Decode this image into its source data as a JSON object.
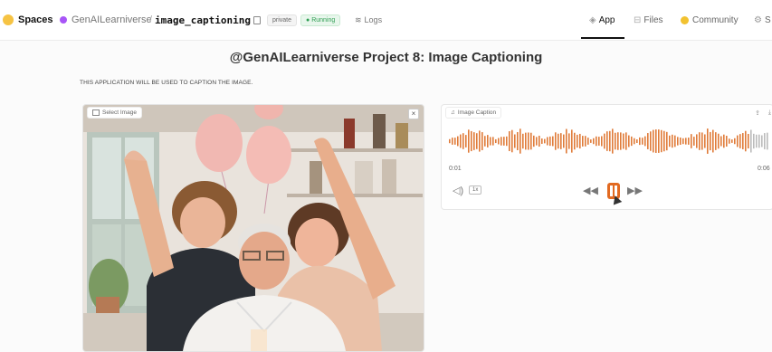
{
  "header": {
    "spaces_label": "Spaces",
    "org": "GenAILearniverse",
    "repo": "image_captioning",
    "visibility": "private",
    "status": "Running",
    "logs_label": "Logs",
    "tabs": [
      {
        "label": "App",
        "active": true
      },
      {
        "label": "Files",
        "active": false
      },
      {
        "label": "Community",
        "active": false
      },
      {
        "label": "S",
        "active": false
      }
    ]
  },
  "main": {
    "title": "@GenAILearniverse Project 8: Image Captioning",
    "description": "THIS APPLICATION WILL BE USED TO CAPTION THE IMAGE."
  },
  "image_input": {
    "label": "Select Image"
  },
  "audio_output": {
    "label": "Image Caption",
    "time_current": "0:01",
    "time_total": "0:06",
    "playback_rate": "1x",
    "accent": "#e07b39"
  }
}
